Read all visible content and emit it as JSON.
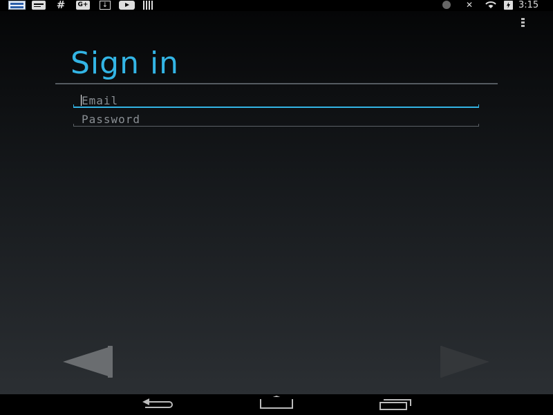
{
  "status_bar": {
    "left_icons": [
      "news-icon",
      "message-icon",
      "hashtag-icon",
      "google-plus-icon",
      "download-icon",
      "youtube-icon",
      "barcode-icon"
    ],
    "right_icons": [
      "bluetooth-icon",
      "mute-icon",
      "wifi-icon",
      "battery-charging-icon"
    ],
    "google_plus_label": "G+",
    "hash_label": "#",
    "time": "3:15"
  },
  "header": {
    "title": "Sign in"
  },
  "form": {
    "email": {
      "value": "",
      "placeholder": "Email"
    },
    "password": {
      "value": "",
      "placeholder": "Password"
    }
  },
  "navigation": {
    "back_enabled": true,
    "next_enabled": false
  },
  "colors": {
    "accent": "#33b5e5",
    "background_top": "#050607",
    "background_bottom": "#2b2f33"
  }
}
